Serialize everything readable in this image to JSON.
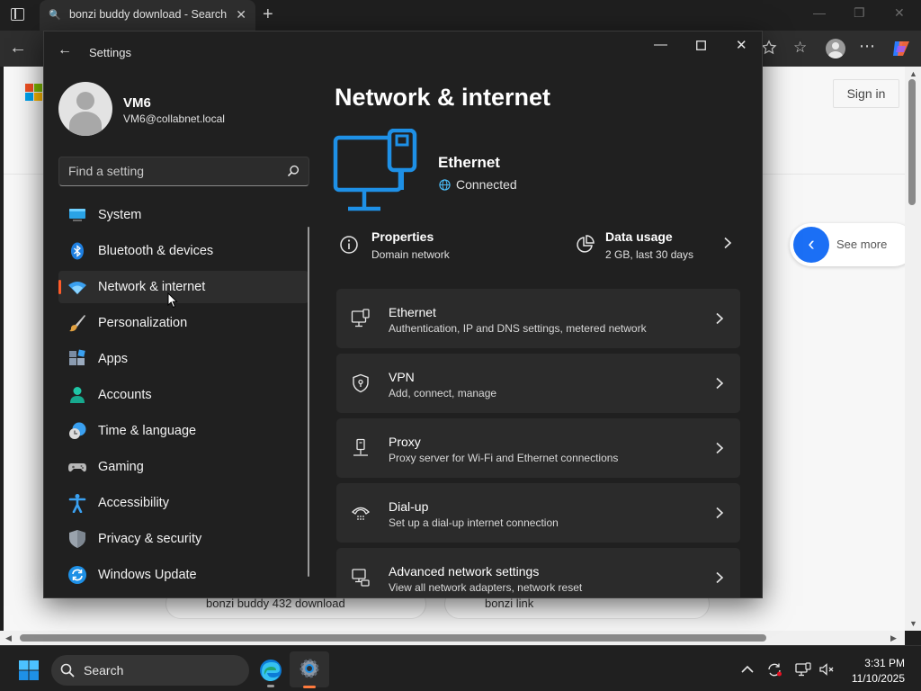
{
  "browser": {
    "tab_title": "bonzi buddy download - Search",
    "new_tab_symbol": "+",
    "close_tab_symbol": "✕",
    "page": {
      "sign_in": "Sign in",
      "see_more": "See more",
      "related": [
        "bonzi buddy 432 download",
        "bonzi link"
      ]
    }
  },
  "settings": {
    "window_title": "Settings",
    "user": {
      "name": "VM6",
      "email": "VM6@collabnet.local"
    },
    "search": {
      "placeholder": "Find a setting"
    },
    "nav": [
      {
        "label": "System",
        "icon": "system-icon"
      },
      {
        "label": "Bluetooth & devices",
        "icon": "bluetooth-icon"
      },
      {
        "label": "Network & internet",
        "icon": "wifi-icon",
        "active": true
      },
      {
        "label": "Personalization",
        "icon": "brush-icon"
      },
      {
        "label": "Apps",
        "icon": "apps-icon"
      },
      {
        "label": "Accounts",
        "icon": "accounts-icon"
      },
      {
        "label": "Time & language",
        "icon": "clock-globe-icon"
      },
      {
        "label": "Gaming",
        "icon": "gamepad-icon"
      },
      {
        "label": "Accessibility",
        "icon": "accessibility-icon"
      },
      {
        "label": "Privacy & security",
        "icon": "shield-icon"
      },
      {
        "label": "Windows Update",
        "icon": "update-icon"
      }
    ],
    "main": {
      "heading": "Network & internet",
      "connection": {
        "name": "Ethernet",
        "status": "Connected"
      },
      "properties": {
        "title": "Properties",
        "subtitle": "Domain network"
      },
      "data_usage": {
        "title": "Data usage",
        "subtitle": "2 GB, last 30 days"
      },
      "cards": [
        {
          "title": "Ethernet",
          "subtitle": "Authentication, IP and DNS settings, metered network",
          "icon": "ethernet-icon"
        },
        {
          "title": "VPN",
          "subtitle": "Add, connect, manage",
          "icon": "vpn-shield-icon"
        },
        {
          "title": "Proxy",
          "subtitle": "Proxy server for Wi-Fi and Ethernet connections",
          "icon": "proxy-icon"
        },
        {
          "title": "Dial-up",
          "subtitle": "Set up a dial-up internet connection",
          "icon": "dialup-icon"
        },
        {
          "title": "Advanced network settings",
          "subtitle": "View all network adapters, network reset",
          "icon": "advanced-network-icon"
        }
      ]
    }
  },
  "taskbar": {
    "search_label": "Search",
    "time": "3:31 PM",
    "date": "11/10/2025"
  },
  "colors": {
    "accent": "#ff5c2a",
    "icon_blue": "#4cc2ff",
    "ethernet_icon": "#1e90e6",
    "window_bg": "#202020",
    "card_bg": "#2b2b2b"
  }
}
